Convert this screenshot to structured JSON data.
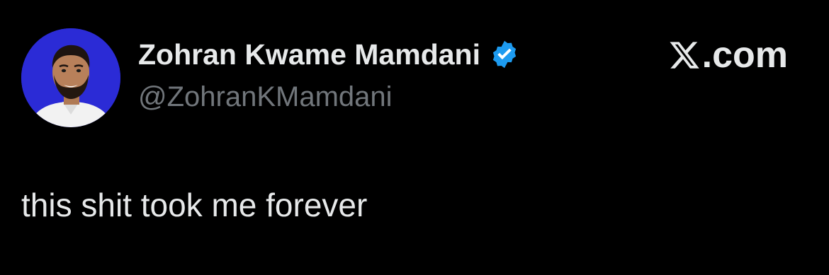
{
  "tweet": {
    "author": {
      "display_name": "Zohran Kwame Mamdani",
      "handle": "@ZohranKMamdani",
      "verified": true,
      "avatar_icon": "profile-photo",
      "avatar_background": "#2b2bd6"
    },
    "site": {
      "logo_icon": "x-logo-icon",
      "domain": ".com"
    },
    "text": "this shit took me forever"
  },
  "colors": {
    "background": "#000000",
    "primary_text": "#e7e9ea",
    "secondary_text": "#71767b",
    "verified_badge": "#1d9bf0"
  }
}
